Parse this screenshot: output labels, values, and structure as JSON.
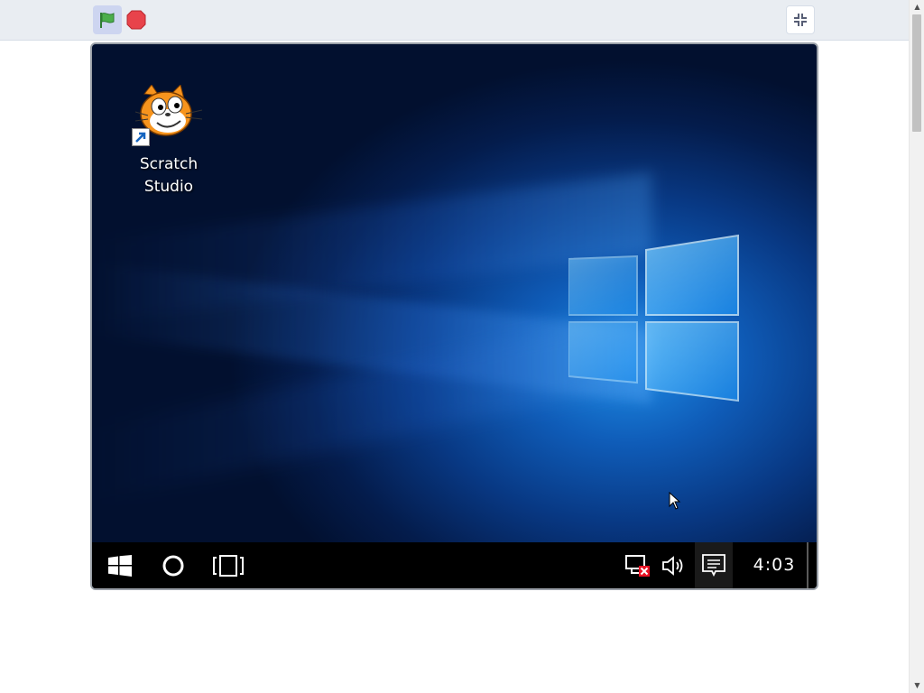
{
  "player": {
    "green_flag_icon": "green-flag-icon",
    "stop_icon": "stop-sign-icon",
    "fullscreen_exit_icon": "exit-fullscreen-icon",
    "colors": {
      "bar": "#e9edf2",
      "flag": "#4cae4c",
      "stop": "#e8434b"
    }
  },
  "desktop": {
    "icons": [
      {
        "label_line1": "Scratch",
        "label_line2": "Studio",
        "icon": "scratch-cat-icon"
      }
    ],
    "wallpaper": "windows-10-hero"
  },
  "taskbar": {
    "start_icon": "windows-start-icon",
    "cortana_icon": "cortana-circle-icon",
    "task_view_icon": "task-view-icon",
    "tray": {
      "network_icon": "network-disconnected-icon",
      "volume_icon": "volume-icon",
      "action_center_icon": "action-center-icon"
    },
    "clock": "4:03"
  }
}
